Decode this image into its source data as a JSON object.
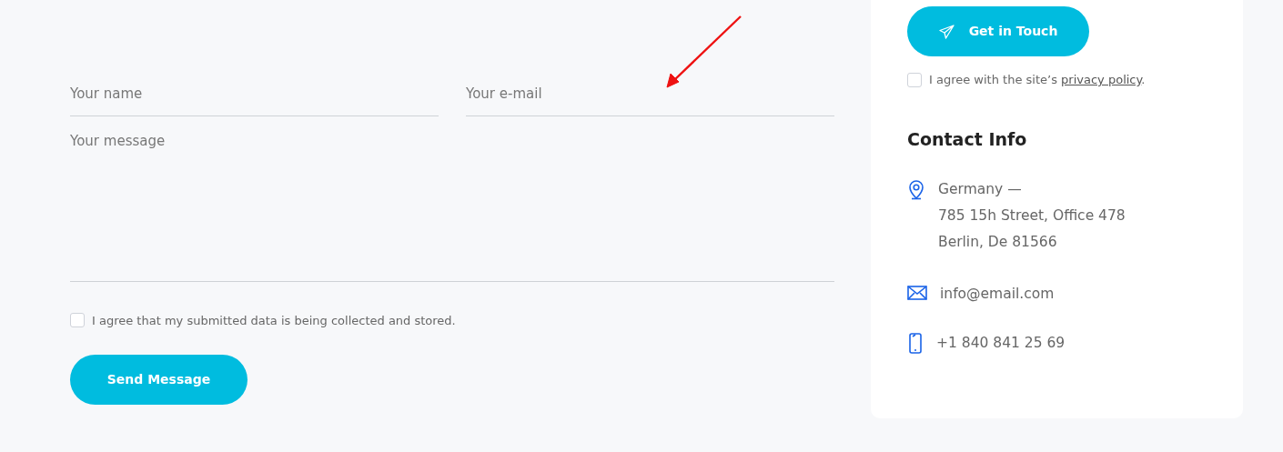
{
  "form": {
    "fields": [
      {
        "kind": "input",
        "placeholder": "Your name"
      },
      {
        "kind": "input",
        "placeholder": "Your e-mail"
      },
      {
        "kind": "textarea",
        "placeholder": "Your message"
      }
    ],
    "consent": {
      "label": "I agree that my submitted data is being collected and stored.",
      "checked": false
    },
    "submit": "Send Message"
  },
  "sidebar": {
    "button": "Get in Touch",
    "privacy": {
      "before": "I agree with the site’s ",
      "link": "privacy policy",
      "after": ".",
      "checked": false
    },
    "heading": "Contact Info",
    "items": [
      {
        "kind": "address",
        "lines": [
          "Germany —",
          "785 15h Street, Office 478",
          "Berlin, De 81566"
        ]
      },
      {
        "kind": "email",
        "lines": [
          "info@email.com"
        ]
      },
      {
        "kind": "phone",
        "lines": [
          "+1 840 841 25 69"
        ]
      }
    ]
  },
  "annotations": [
    {
      "kind": "arrow",
      "color": "#ee1111"
    }
  ]
}
